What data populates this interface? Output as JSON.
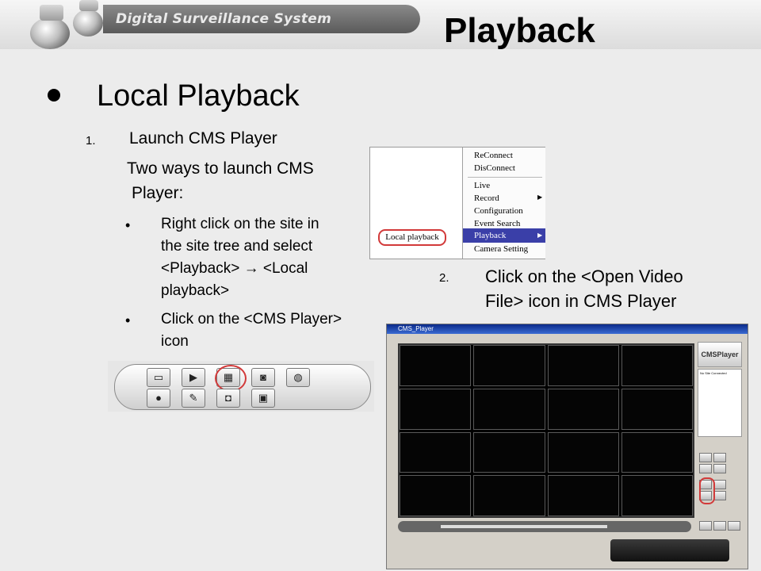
{
  "header": {
    "banner_text": "Digital Surveillance System"
  },
  "slide": {
    "title": "Playback",
    "heading": "Local Playback",
    "step1": {
      "num": "1.",
      "text": "Launch CMS Player"
    },
    "intro_line1": "Two ways to launch CMS",
    "intro_line2": "Player:",
    "bullets": [
      {
        "line1": "Right click on the site in",
        "line2": "the site tree and select",
        "line3": "<Playback>  →  <Local",
        "line4": "playback>"
      },
      {
        "line1": "Click on the <CMS Player>",
        "line2": "icon"
      }
    ],
    "step2": {
      "num": "2.",
      "line1": "Click on the <Open Video",
      "line2": "File> icon in CMS Player"
    }
  },
  "context_menu": {
    "items": [
      "ReConnect",
      "DisConnect",
      "Live",
      "Record",
      "Configuration",
      "Event Search",
      "Playback",
      "Camera Setting"
    ],
    "submenu_items": [
      "Record",
      "Playback"
    ],
    "selected": "Playback",
    "local_option": "Local playback"
  },
  "player": {
    "window_title": "CMS_Player",
    "logo": "CMSPlayer",
    "list_status": "No Site Connected"
  },
  "toolbar": {
    "icons": [
      "live-tv-icon",
      "play-icon",
      "open-video-file-icon",
      "snapshot-icon",
      "network-icon",
      "camera-icon",
      "edit-icon",
      "record-icon",
      "lock-icon"
    ]
  },
  "colors": {
    "highlight": "#d23a3a",
    "menu_selected": "#3a3fa8",
    "title_bar": "#0a2a8a"
  }
}
